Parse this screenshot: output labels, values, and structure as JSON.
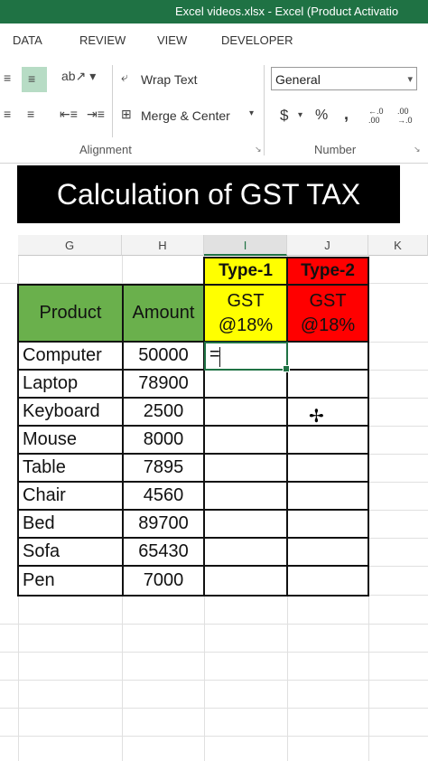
{
  "window": {
    "title": "Excel videos.xlsx -  Excel (Product Activatio"
  },
  "menu": {
    "tabs": [
      "DATA",
      "REVIEW",
      "VIEW",
      "DEVELOPER"
    ]
  },
  "ribbon": {
    "wrap_text": "Wrap Text",
    "merge_center": "Merge & Center",
    "number_format": "General",
    "alignment_label": "Alignment",
    "number_label": "Number",
    "currency_symbol": "$",
    "percent_symbol": "%",
    "comma_symbol": ",",
    "increase_decimal": "←.0 .00",
    "decrease_decimal": ".00 →.0"
  },
  "banner": {
    "text": "Calculation of GST TAX"
  },
  "columns": [
    "G",
    "H",
    "I",
    "J",
    "K"
  ],
  "table": {
    "headers": {
      "product": "Product",
      "amount": "Amount"
    },
    "type1": {
      "label": "Type-1",
      "line1": "GST",
      "line2": "@18%"
    },
    "type2": {
      "label": "Type-2",
      "line1": "GST",
      "line2": "@18%"
    },
    "rows": [
      {
        "product": "Computer",
        "amount": "50000"
      },
      {
        "product": "Laptop",
        "amount": "78900"
      },
      {
        "product": "Keyboard",
        "amount": "2500"
      },
      {
        "product": "Mouse",
        "amount": "8000"
      },
      {
        "product": "Table",
        "amount": "7895"
      },
      {
        "product": "Chair",
        "amount": "4560"
      },
      {
        "product": "Bed",
        "amount": "89700"
      },
      {
        "product": "Sofa",
        "amount": "65430"
      },
      {
        "product": "Pen",
        "amount": "7000"
      }
    ],
    "active_cell_entry": "="
  },
  "colors": {
    "excel_green": "#1f7244",
    "header_green": "#6ab04c",
    "type1_yellow": "#ffff00",
    "type2_red": "#ff0000"
  }
}
